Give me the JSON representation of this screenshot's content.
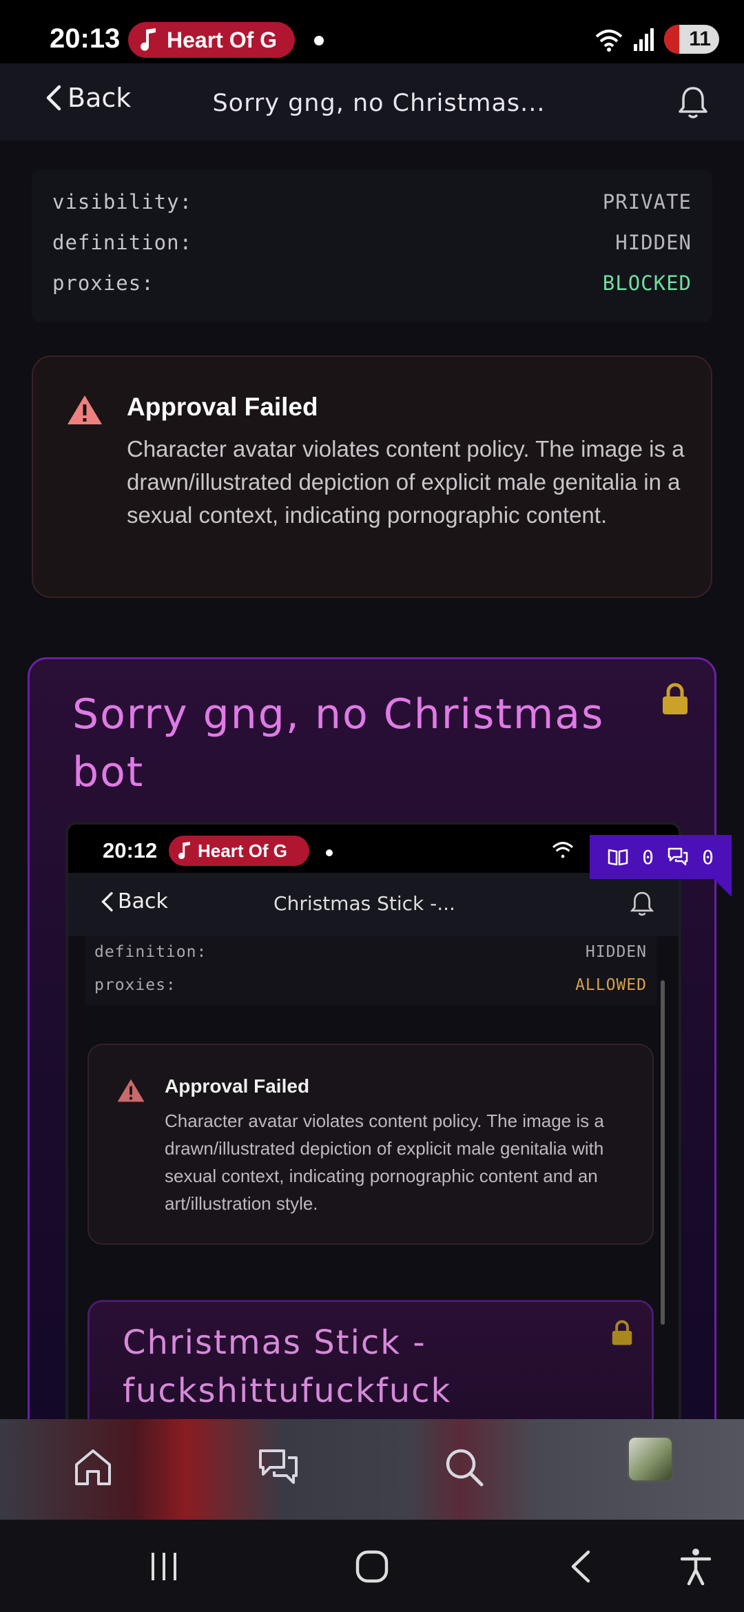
{
  "status_bar": {
    "time": "20:13",
    "media_pill": "Heart Of G",
    "battery": "11"
  },
  "header": {
    "back_label": "Back",
    "title": "Sorry gng, no Christmas..."
  },
  "meta": [
    {
      "label": "visibility:",
      "value": "PRIVATE"
    },
    {
      "label": "definition:",
      "value": "HIDDEN"
    },
    {
      "label": "proxies:",
      "value": "BLOCKED"
    }
  ],
  "approval": {
    "title": "Approval Failed",
    "text": "Character avatar violates content policy. The image is a drawn/illustrated depiction of explicit male genitalia in a sexual context, indicating pornographic content."
  },
  "bot": {
    "title": "Sorry gng, no Christmas bot"
  },
  "nested_screenshot": {
    "time": "20:12",
    "media_pill": "Heart Of G",
    "back_label": "Back",
    "title": "Christmas Stick -...",
    "meta": [
      {
        "label": "definition:",
        "value": "HIDDEN"
      },
      {
        "label": "proxies:",
        "value": "ALLOWED"
      }
    ],
    "approval_title": "Approval Failed",
    "approval_text": "Character avatar violates content policy. The image is a drawn/illustrated depiction of explicit male genitalia with sexual context, indicating pornographic content and an art/illustration style.",
    "bot_title": "Christmas Stick - fuckshittufuckfuck"
  },
  "overlay": {
    "count_a": "0",
    "count_b": "0"
  },
  "colors": {
    "accent_pink": "#e07ae6",
    "card_border_purple": "#6a1fa8",
    "blocked_green": "#6ee0a0",
    "allowed_orange": "#d8a04a",
    "warning_red": "#f08080",
    "lock_gold": "#c9a227"
  },
  "icons": [
    "music-note-icon",
    "wifi-icon",
    "signal-icon",
    "chevron-left-icon",
    "bell-icon",
    "warning-icon",
    "lock-icon",
    "book-icon",
    "chat-icon",
    "home-icon",
    "messages-icon",
    "search-icon",
    "recents-icon",
    "home-circle-icon",
    "back-icon",
    "accessibility-icon"
  ]
}
